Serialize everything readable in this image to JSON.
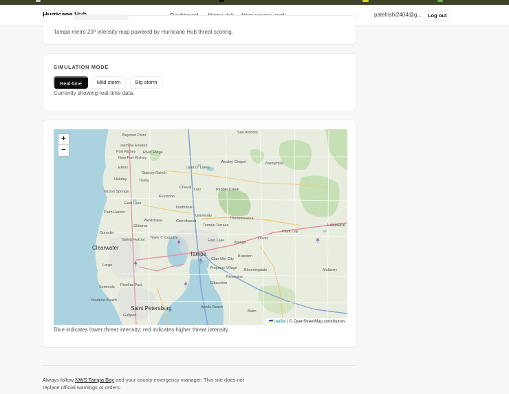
{
  "nav": {
    "brand": "Hurricane Hub",
    "links": [
      "Dashboard",
      "Home risk",
      "How scores work"
    ],
    "user_email": "patelrishi2404@g...",
    "logout_label": "Log out"
  },
  "header_card": {
    "description": "Tampa metro ZIP intensity map powered by Hurricane Hub threat scoring."
  },
  "simulation": {
    "section_label": "SIMULATION MODE",
    "modes": [
      "Real-time",
      "Mild storm",
      "Big storm"
    ],
    "active_mode": "Real-time",
    "status": "Currently showing real-time data."
  },
  "map": {
    "zoom_in": "+",
    "zoom_out": "−",
    "attribution_leaflet": "Leaflet",
    "attribution_rest": "| © OpenStreetMap contributors",
    "legend_note": "Blue indicates lower threat intensity; red indicates higher threat intensity.",
    "places": {
      "bayonet_point": "Bayonet Point",
      "san_antonio": "San Antonio",
      "jasmine_estates": "Jasmine Estates",
      "port_richey": "Port Richey",
      "river_ridge": "River Ridge",
      "new_port_richey": "New Port Richey",
      "elfers": "Elfers",
      "land_o_lakes": "Land O' Lakes",
      "wesley_chapel": "Wesley Chapel",
      "zephyrhills": "Zephyrhills",
      "holiday": "Holiday",
      "starkey_ranch": "Starkey Ranch",
      "trinity": "Trinity",
      "cheval": "Cheval",
      "lutz": "Lutz",
      "pebble_creek": "Pebble Creek",
      "tarpon_springs": "Tarpon Springs",
      "keystone": "Keystone",
      "east_lake": "East Lake",
      "northdale": "Northdale",
      "palm_harbor": "Palm Harbor",
      "university": "University",
      "westchase": "Westchase",
      "carrollwood": "Carrollwood",
      "thonotosassa": "Thonotosassa",
      "lakeland": "Lakeland",
      "oldsmar": "Oldsmar",
      "temple_terrace": "Temple Terrace",
      "dunedin": "Dunedin",
      "plant_city": "Plant City",
      "safety_harbor": "Safety Harbor",
      "town_n_country": "Town 'n' Country",
      "east_lake_2": "East Lake",
      "mango": "Mango",
      "dover": "Dover",
      "clearwater": "Clearwater",
      "tampa": "Tampa",
      "clair_mel_city": "Clair-Mel City",
      "brandon": "Brandon",
      "largo": "Largo",
      "progress_village": "Progress Village",
      "bloomingdale": "Bloomingdale",
      "mulberry": "Mulberry",
      "riverview": "Riverview",
      "seminole": "Seminole",
      "pinellas_park": "Pinellas Park",
      "gibsonton": "Gibsonton",
      "madeira_beach": "Madeira Beach",
      "saint_petersburg": "Saint Petersburg",
      "apollo_beach": "Apollo Beach",
      "gulfport": "Gulfport",
      "balm": "Balm"
    }
  },
  "footer": {
    "before": "Always follow ",
    "link": "NWS Tampa Bay",
    "after": " and your county emergency manager. This site does not replace official warnings or orders."
  },
  "colors": {
    "accent_dark": "#0e0e0e",
    "top_strip": "#3e4226",
    "water": "#aad3df",
    "land": "#e9ede0",
    "park": "#b9d6a6"
  }
}
